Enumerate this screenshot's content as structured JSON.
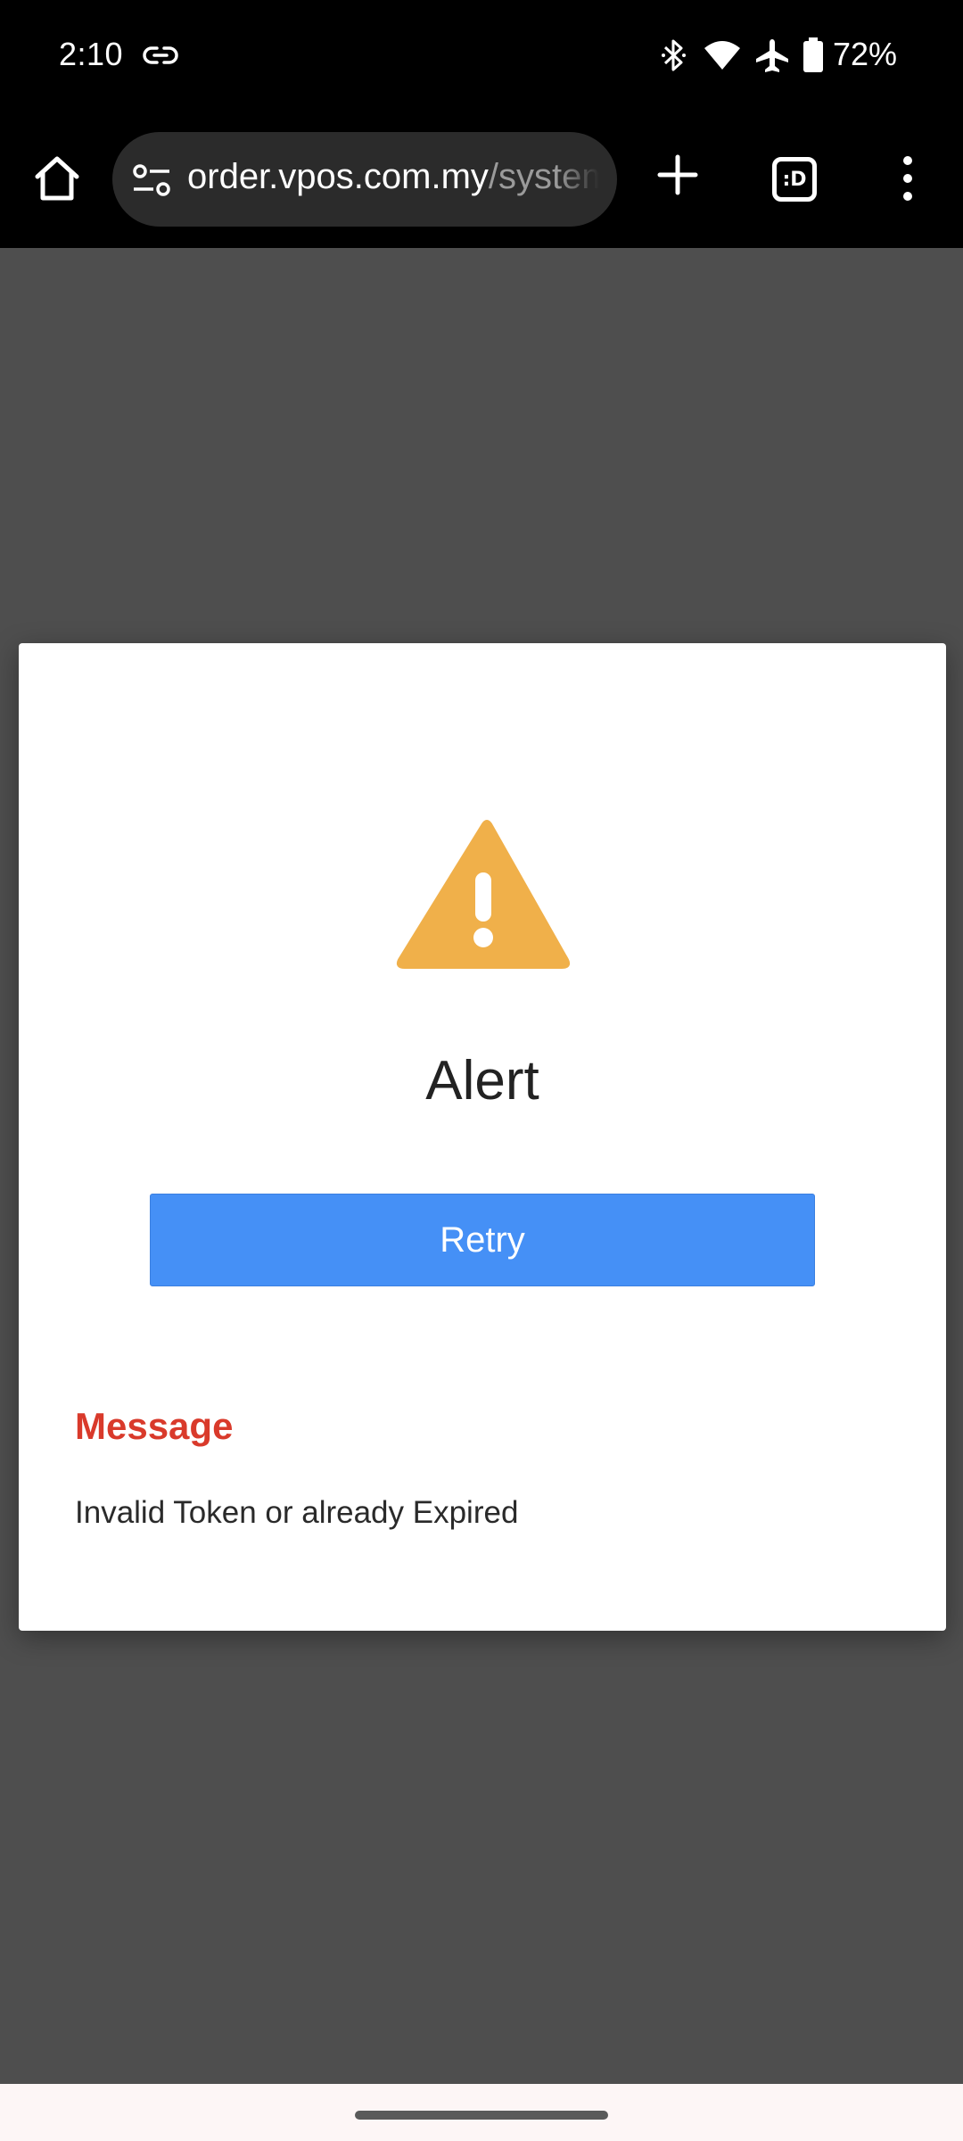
{
  "status_bar": {
    "time": "2:10",
    "battery": "72%",
    "icons": [
      "link-icon",
      "bluetooth-icon",
      "wifi-icon",
      "airplane-icon",
      "battery-icon"
    ]
  },
  "browser": {
    "url_host": "order.vpos.com.my",
    "url_path": "/system",
    "tab_count": ":D",
    "icons": [
      "home-icon",
      "site-settings-icon",
      "new-tab-icon",
      "tab-switcher-icon",
      "more-menu-icon"
    ]
  },
  "dialog": {
    "icon": "warning-icon",
    "icon_color": "#f0b04a",
    "title": "Alert",
    "retry_label": "Retry",
    "retry_color": "#4590f6",
    "message_heading": "Message",
    "message_heading_color": "#d93a2b",
    "message_text": "Invalid Token or already Expired"
  }
}
